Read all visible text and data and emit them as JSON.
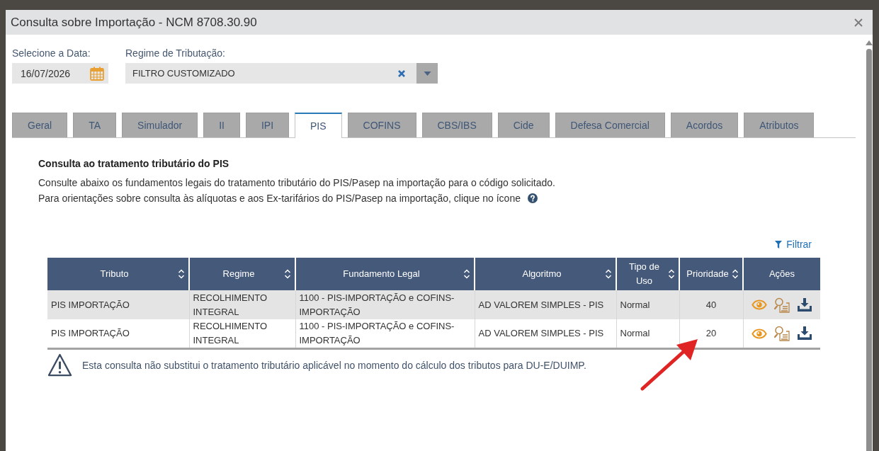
{
  "window": {
    "title": "Consulta sobre Importação - NCM 8708.30.90"
  },
  "filters": {
    "date": {
      "label": "Selecione a Data:",
      "value": "16/07/2026"
    },
    "regime": {
      "label": "Regime de Tributação:",
      "value": "FILTRO CUSTOMIZADO"
    }
  },
  "tabs": [
    {
      "label": "Geral",
      "selected": false
    },
    {
      "label": "TA",
      "selected": false
    },
    {
      "label": "Simulador",
      "selected": false
    },
    {
      "label": "II",
      "selected": false
    },
    {
      "label": "IPI",
      "selected": false
    },
    {
      "label": "PIS",
      "selected": true
    },
    {
      "label": "COFINS",
      "selected": false
    },
    {
      "label": "CBS/IBS",
      "selected": false
    },
    {
      "label": "Cide",
      "selected": false
    },
    {
      "label": "Defesa Comercial",
      "selected": false
    },
    {
      "label": "Acordos",
      "selected": false
    },
    {
      "label": "Atributos",
      "selected": false
    }
  ],
  "panel": {
    "title": "Consulta ao tratamento tributário do PIS",
    "paragraphs": [
      "Consulte abaixo os fundamentos legais do tratamento tributário do PIS/Pasep na importação para o código solicitado.",
      "Para orientações sobre consulta às alíquotas e aos Ex-tarifários do PIS/Pasep na importação, clique no ícone"
    ],
    "filter_link": "Filtrar",
    "table": {
      "columns": [
        {
          "label": "Tributo",
          "kind": "text",
          "sortable": true
        },
        {
          "label": "Regime",
          "kind": "text",
          "sortable": true
        },
        {
          "label": "Fundamento Legal",
          "kind": "text",
          "sortable": true
        },
        {
          "label": "Algoritmo",
          "kind": "text",
          "sortable": true
        },
        {
          "label": "Tipo de Uso",
          "kind": "text",
          "sortable": true
        },
        {
          "label": "Prioridade",
          "kind": "number",
          "sortable": true
        },
        {
          "label": "Ações",
          "kind": "actions",
          "sortable": false
        }
      ],
      "rows": [
        {
          "cells": [
            "PIS IMPORTAÇÃO",
            "RECOLHIMENTO INTEGRAL",
            "1100 - PIS-IMPORTAÇÃO e COFINS-IMPORTAÇÃO",
            "AD VALOREM SIMPLES - PIS",
            "Normal",
            "40"
          ]
        },
        {
          "cells": [
            "PIS IMPORTAÇÃO",
            "RECOLHIMENTO INTEGRAL",
            "1100 - PIS-IMPORTAÇÃO e COFINS-IMPORTAÇÃO",
            "AD VALOREM SIMPLES - PIS",
            "Normal",
            "20"
          ]
        }
      ]
    },
    "notice": "Esta consulta não substitui o tratamento tributário aplicável no momento do cálculo dos tributos para DU-E/DUIMP."
  }
}
